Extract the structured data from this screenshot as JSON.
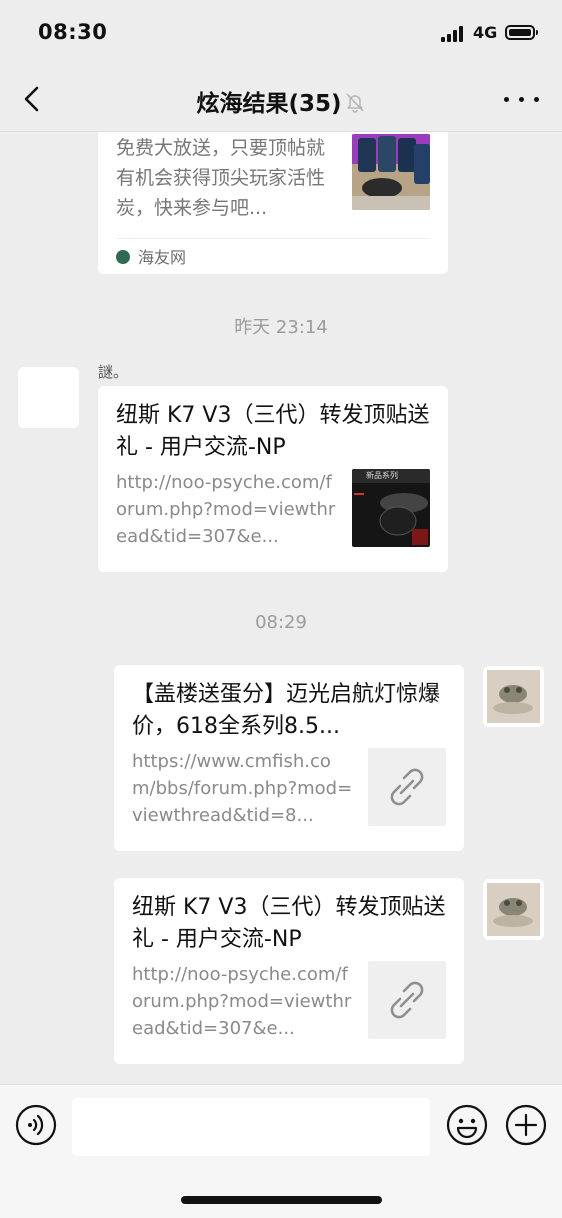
{
  "status_bar": {
    "time": "08:30",
    "network": "4G",
    "icons": [
      "signal-icon",
      "battery-icon"
    ]
  },
  "nav": {
    "title": "炫海结果(35)",
    "icons": [
      "back-icon",
      "mute-bell-icon",
      "more-icon"
    ]
  },
  "messages": [
    {
      "type": "link-card",
      "direction": "incoming",
      "desc": "免费大放送，只要顶帖就有机会获得顶尖玩家活性炭，快来参与吧...",
      "source": "海友网",
      "thumbnail": "product-jars-photo"
    },
    {
      "type": "timestamp",
      "text": "昨天 23:14"
    },
    {
      "type": "link-card",
      "direction": "incoming",
      "sender": "謎。",
      "title": "纽斯 K7 V3（三代）转发顶贴送礼 - 用户交流-NP",
      "desc": "http://noo-psyche.com/forum.php?mod=viewthread&tid=307&e...",
      "thumbnail": "aquarium-light-photo",
      "thumbnail_caption": "新品系列"
    },
    {
      "type": "timestamp",
      "text": "08:29"
    },
    {
      "type": "link-card",
      "direction": "outgoing",
      "title": "【盖楼送蛋分】迈光启航灯惊爆价，618全系列8.5...",
      "desc": "https://www.cmfish.com/bbs/forum.php?mod=viewthread&tid=8...",
      "thumbnail": "link-icon"
    },
    {
      "type": "link-card",
      "direction": "outgoing",
      "title": "纽斯 K7 V3（三代）转发顶贴送礼 - 用户交流-NP",
      "desc": "http://noo-psyche.com/forum.php?mod=viewthread&tid=307&e...",
      "thumbnail": "link-icon"
    }
  ],
  "input_bar": {
    "placeholder": "",
    "icons": [
      "voice-icon",
      "emoji-icon",
      "plus-icon"
    ]
  },
  "colors": {
    "background": "#ededed",
    "card": "#ffffff",
    "secondary_text": "#8a8a8a",
    "timestamp": "#9c9c9c",
    "input_bar": "#f6f6f6"
  }
}
